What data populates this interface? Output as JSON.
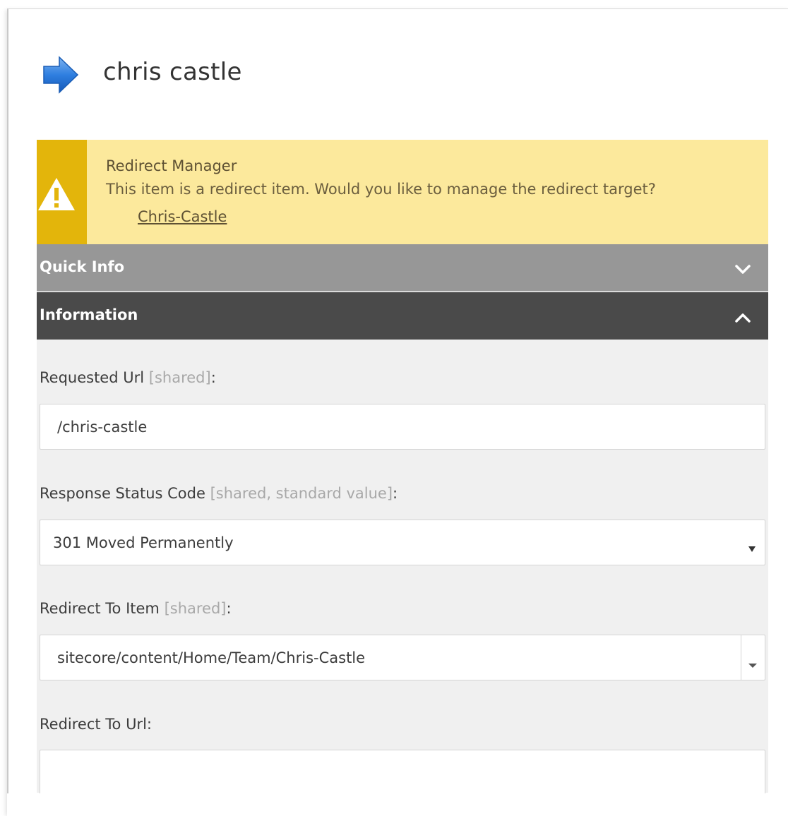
{
  "item": {
    "title": "chris castle",
    "icon": "blue-arrow-right-icon"
  },
  "warning": {
    "icon": "warning-triangle-icon",
    "title": "Redirect Manager",
    "message": "This item is a redirect item. Would you like to manage the redirect target?",
    "link": "Chris-Castle"
  },
  "sections": {
    "quick_info": {
      "label": "Quick Info",
      "icon": "chevron-down-icon"
    },
    "information": {
      "label": "Information",
      "icon": "chevron-up-icon"
    }
  },
  "fields": {
    "requested_url": {
      "label": "Requested Url",
      "meta": "[shared]",
      "suffix": ":",
      "value": "/chris-castle"
    },
    "response_status_code": {
      "label": "Response Status Code",
      "meta": "[shared, standard value]",
      "suffix": ":",
      "value": "301 Moved Permanently"
    },
    "redirect_to_item": {
      "label": "Redirect To Item",
      "meta": "[shared]",
      "suffix": ":",
      "value": "sitecore/content/Home/Team/Chris-Castle"
    },
    "redirect_to_url": {
      "label": "Redirect To Url:",
      "value": ""
    }
  },
  "colors": {
    "warning_bg": "#fce99c",
    "warning_accent": "#e3b50b",
    "quick_info_bar": "#979797",
    "information_bar": "#4a4a4a",
    "body_bg": "#f0f0f0"
  }
}
